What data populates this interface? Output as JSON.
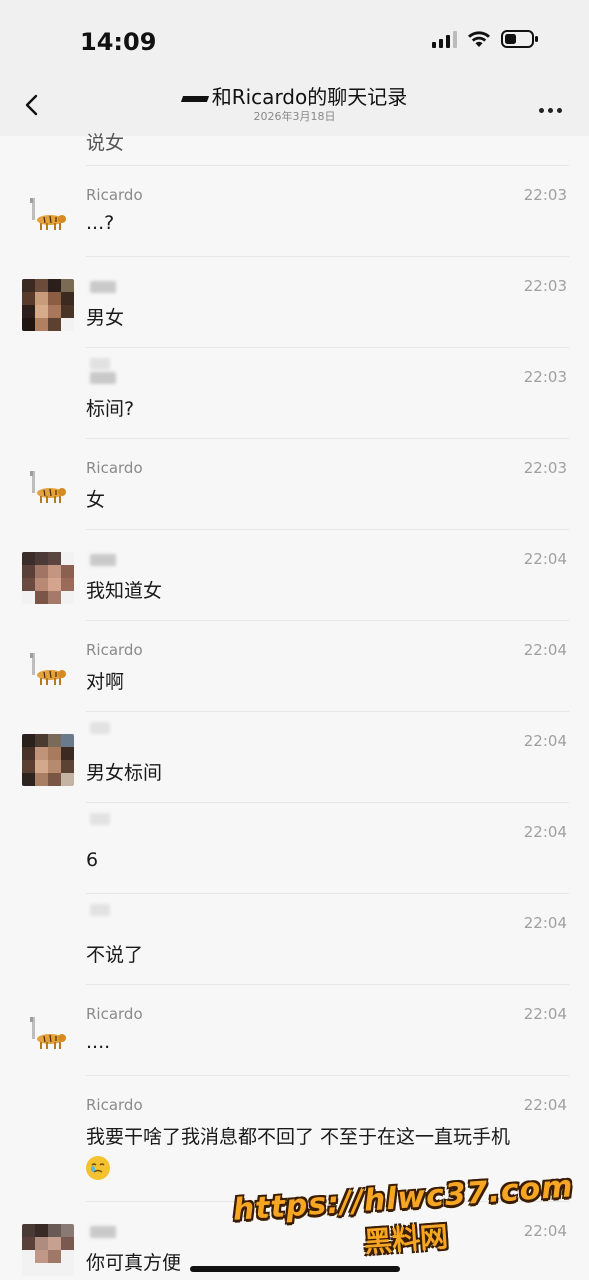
{
  "status": {
    "time": "14:09"
  },
  "nav": {
    "title": "和Ricardo的聊天记录",
    "subtitle": "2026年3月18日"
  },
  "messages": [
    {
      "sender": "",
      "time": "",
      "text": "说女"
    },
    {
      "sender": "Ricardo",
      "time": "22:03",
      "text": "...?"
    },
    {
      "sender": "",
      "time": "22:03",
      "text": "男女"
    },
    {
      "sender": "",
      "time": "22:03",
      "text": "标间?"
    },
    {
      "sender": "Ricardo",
      "time": "22:03",
      "text": "女"
    },
    {
      "sender": "",
      "time": "22:04",
      "text": "我知道女"
    },
    {
      "sender": "Ricardo",
      "time": "22:04",
      "text": "对啊"
    },
    {
      "sender": "",
      "time": "22:04",
      "text": "男女标间"
    },
    {
      "sender": "",
      "time": "22:04",
      "text": "6"
    },
    {
      "sender": "",
      "time": "22:04",
      "text": "不说了"
    },
    {
      "sender": "Ricardo",
      "time": "22:04",
      "text": "...."
    },
    {
      "sender": "Ricardo",
      "time": "22:04",
      "text": "我要干啥了我消息都不回了 不至于在这一直玩手机"
    },
    {
      "sender": "",
      "time": "22:04",
      "text": "你可真方便"
    }
  ],
  "watermark": {
    "url": "https://hlwc37.com",
    "name": "黑料网"
  },
  "icons": {
    "back": "back-chevron-icon",
    "more": "more-dots-icon",
    "signal": "signal-icon",
    "wifi": "wifi-icon",
    "battery": "battery-icon",
    "tiger": "tiger-avatar",
    "emoji": "facepalm-emoji"
  }
}
